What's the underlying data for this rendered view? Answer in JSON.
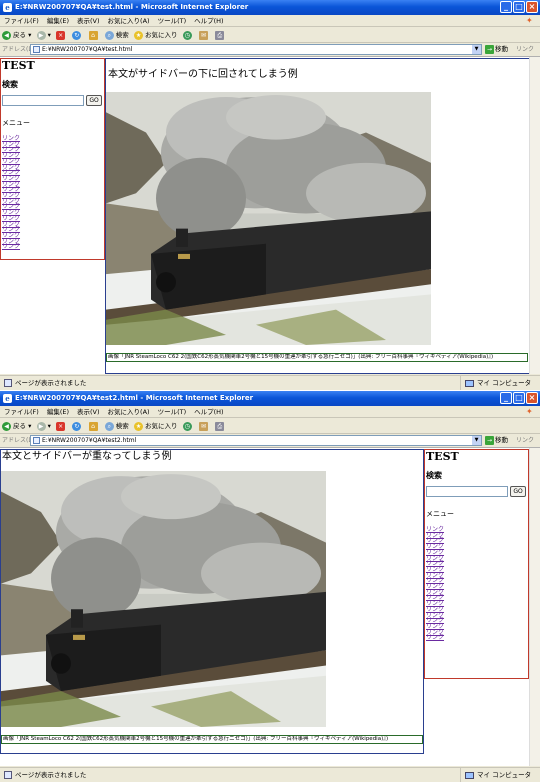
{
  "windows": [
    {
      "title": "E:¥NRW200707¥QA¥test.html - Microsoft Internet Explorer",
      "address": "E:¥NRW200707¥QA¥test.html",
      "main_heading": "本文がサイドバーの下に回されてしまう例",
      "status_text": "ページが表示されました",
      "zone_text": "マイ コンピュータ"
    },
    {
      "title": "E:¥NRW200707¥QA¥test2.html - Microsoft Internet Explorer",
      "address": "E:¥NRW200707¥QA¥test2.html",
      "main_heading": "本文とサイドバーが重なってしまう例",
      "status_text": "ページが表示されました",
      "zone_text": "マイ コンピュータ"
    }
  ],
  "menu": {
    "file": "ファイル(F)",
    "edit": "編集(E)",
    "view": "表示(V)",
    "favorites": "お気に入り(A)",
    "tools": "ツール(T)",
    "help": "ヘルプ(H)"
  },
  "toolbar": {
    "back": "戻る",
    "search": "検索",
    "favorites": "お気に入り"
  },
  "address_bar": {
    "label": "アドレス(D)",
    "go": "移動",
    "links": "リンク"
  },
  "sidebar": {
    "site_title": "TEST",
    "search_heading": "検索",
    "search_button": "GO",
    "menu_heading": "メニュー",
    "link_label": "リンク",
    "links": [
      "リンク",
      "リンク",
      "リンク",
      "リンク",
      "リンク",
      "リンク",
      "リンク",
      "リンク",
      "リンク",
      "リンク",
      "リンク",
      "リンク",
      "リンク",
      "リンク",
      "リンク",
      "リンク",
      "リンク",
      "リンク",
      "リンク",
      "リンク"
    ]
  },
  "photo": {
    "caption": "画像「JNR SteamLoco C62 2(国鉄C62形蒸気機関車2号機と15号機の重連が牽引する急行ニセコ)」(出典: フリー百科事典『ウィキペディア(Wikipedia)』)"
  },
  "colors": {
    "titlebar": "#0a55d8",
    "sidebar_border": "#c0392b",
    "main_border": "#2a3f8f",
    "caption_border": "#2a6b2a",
    "visited_link": "#6a2aa0"
  },
  "icons": [
    "ie-icon",
    "minimize-icon",
    "maximize-icon",
    "close-icon",
    "windows-logo-icon",
    "back-icon",
    "forward-icon",
    "stop-icon",
    "refresh-icon",
    "home-icon",
    "search-icon",
    "favorites-icon",
    "history-icon",
    "mail-icon",
    "print-icon",
    "page-icon",
    "go-icon",
    "status-page-icon",
    "computer-icon"
  ]
}
